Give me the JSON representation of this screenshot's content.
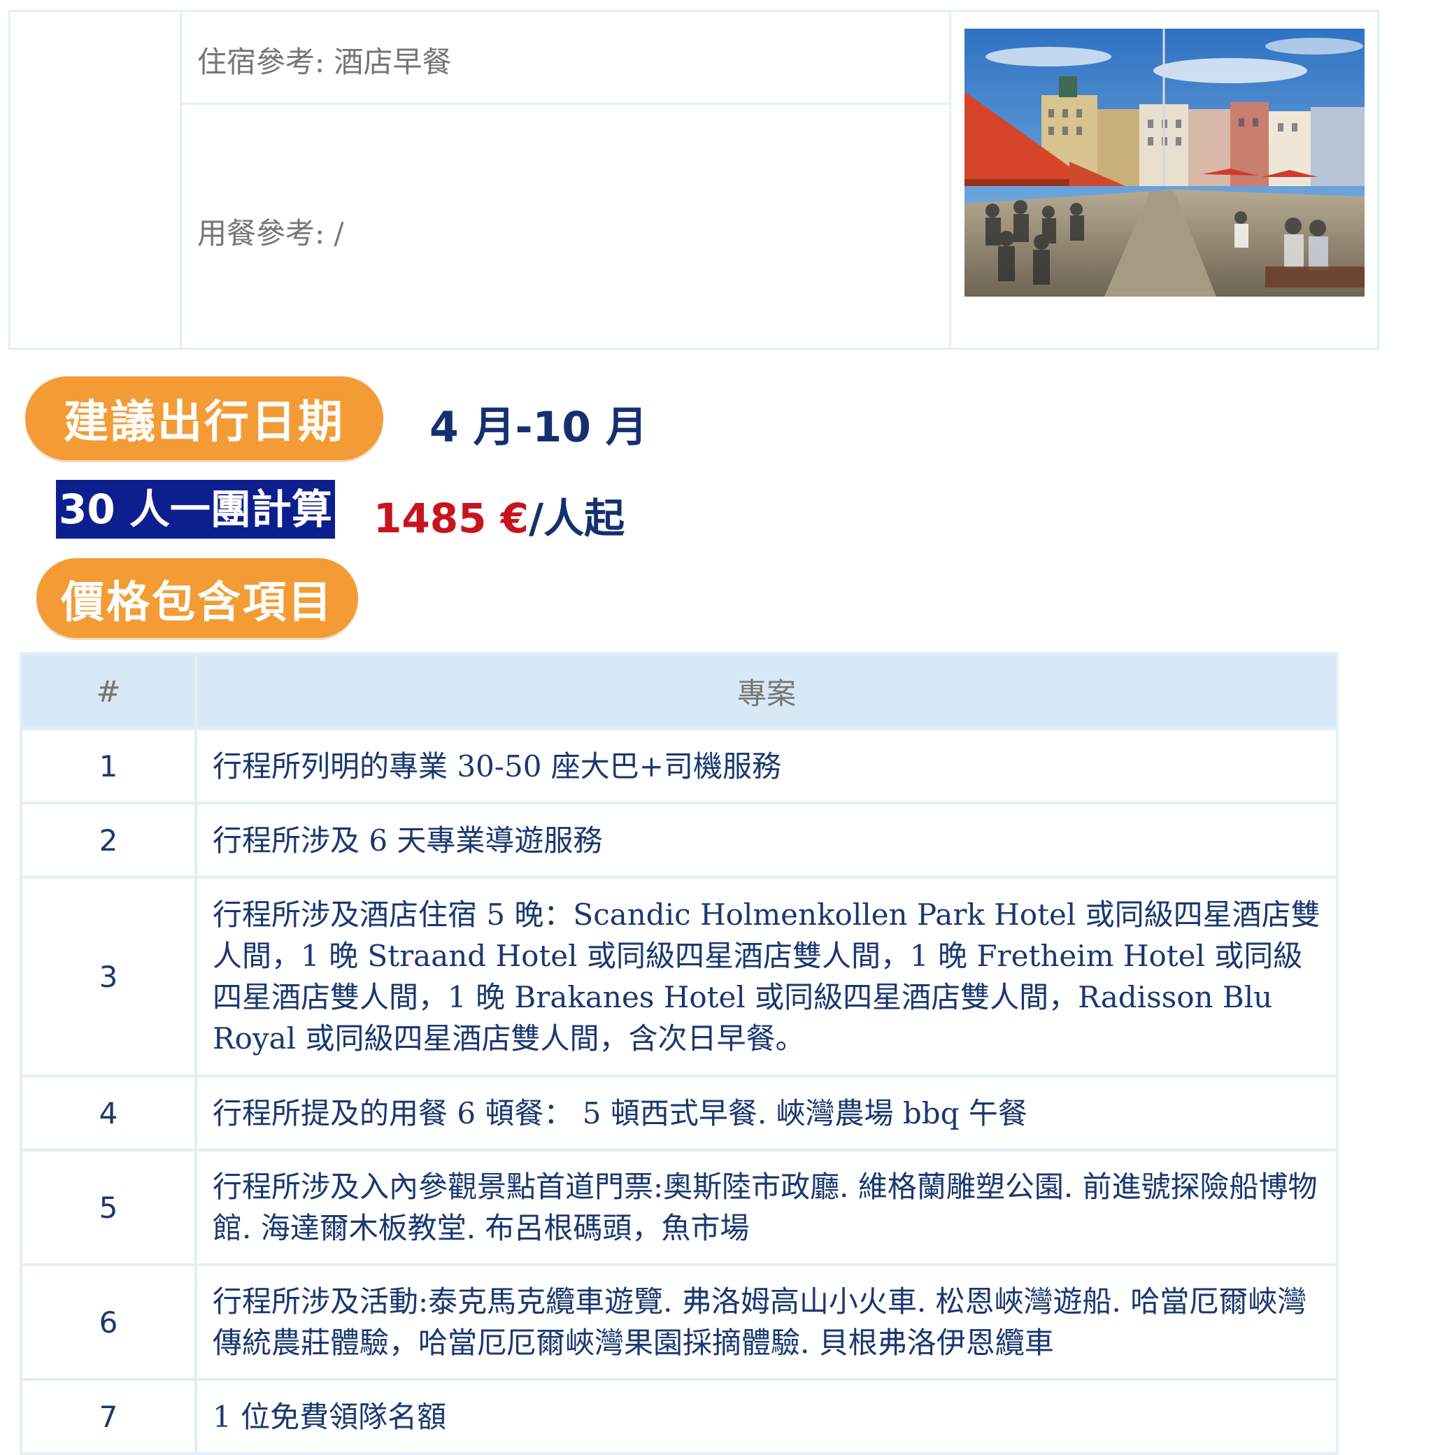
{
  "top_info": {
    "accommodation": "住宿參考: 酒店早餐",
    "meals": "用餐參考: /"
  },
  "photo": {
    "subject": "bergen-harbour-photo",
    "colors": {
      "sky": "#4b8fd1",
      "awning": "#d6452a",
      "pavement": "#8b8070"
    }
  },
  "travel_dates": {
    "badge_label": "建議出行日期",
    "value": "4 月-10 月"
  },
  "pricing": {
    "group_label": "30 人一團計算",
    "amount": "1485 €",
    "unit": "/人起"
  },
  "included": {
    "badge_label": "價格包含項目",
    "headers": [
      "#",
      "專案"
    ],
    "rows": [
      {
        "num": "1",
        "text": "行程所列明的專業 30-50 座大巴+司機服務"
      },
      {
        "num": "2",
        "text": "行程所涉及 6 天專業導遊服務"
      },
      {
        "num": "3",
        "text": "行程所涉及酒店住宿 5 晚：Scandic  Holmenkollen  Park Hotel 或同級四星酒店雙人間，1 晚 Straand  Hotel 或同級四星酒店雙人間，1 晚 Fretheim Hotel 或同級四星酒店雙人間，1 晚 Brakanes  Hotel 或同級四星酒店雙人間，Radisson Blu Royal 或同級四星酒店雙人間，含次日早餐。"
      },
      {
        "num": "4",
        "text": "行程所提及的用餐 6 頓餐：  5 頓西式早餐. 峽灣農場 bbq 午餐"
      },
      {
        "num": "5",
        "text": "行程所涉及入內參觀景點首道門票:奧斯陸市政廳. 維格蘭雕塑公園. 前進號探險船博物館. 海達爾木板教堂. 布呂根碼頭，魚市場"
      },
      {
        "num": "6",
        "text": "行程所涉及活動:泰克馬克纜車遊覽. 弗洛姆高山小火車. 松恩峽灣遊船. 哈當厄爾峽灣傳統農莊體驗，哈當厄厄爾峽灣果園採摘體驗. 貝根弗洛伊恩纜車"
      },
      {
        "num": "7",
        "text": "1 位免費領隊名額"
      }
    ]
  },
  "colors": {
    "badge_orange": "#f39c35",
    "navy_text": "#14306e",
    "price_red": "#c7141d",
    "group_highlight": "#0d1f8f",
    "table_header_bg": "#d7e9f7",
    "border": "#e3eef6"
  }
}
